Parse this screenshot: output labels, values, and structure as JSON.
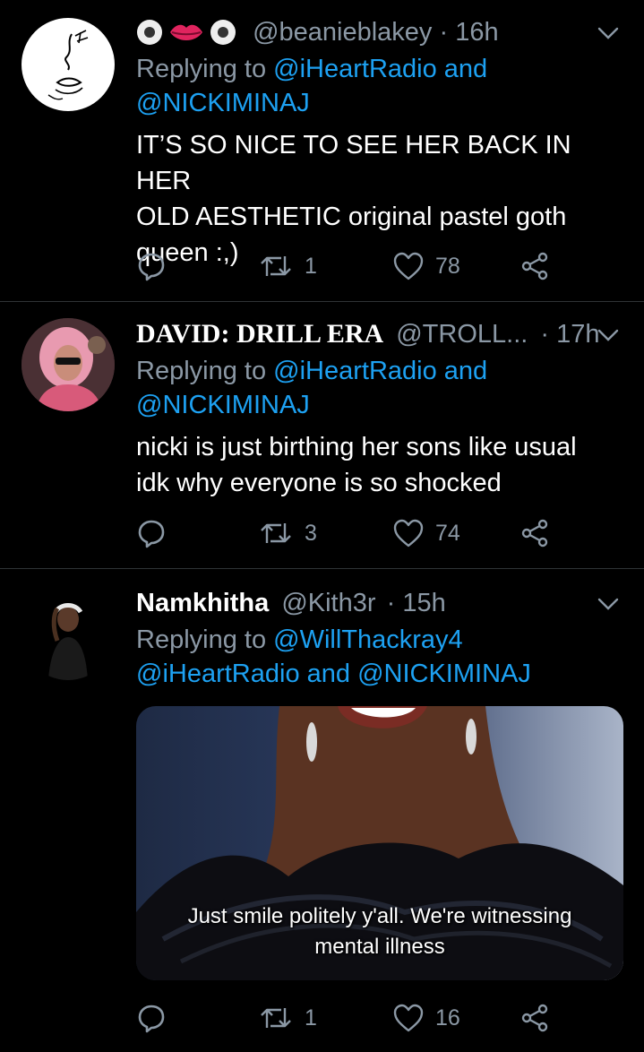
{
  "tweets": [
    {
      "name": "",
      "name_emojis": [
        "eye-emoji",
        "lips-emoji",
        "eye-emoji"
      ],
      "handle": "@beanieblakey",
      "time": "16h",
      "reply_prefix": "Replying to",
      "reply_line1": "@iHeartRadio and",
      "reply_line2": "@NICKIMINAJ",
      "body_lines": [
        "IT’S SO NICE TO SEE HER BACK IN HER",
        "OLD AESTHETIC original pastel goth",
        "queen :,)"
      ],
      "retweets": "1",
      "likes": "78"
    },
    {
      "name": "DAVID: DRILL ERA",
      "handle": "@TROLL...",
      "time": "17h",
      "reply_prefix": "Replying to",
      "reply_line1": "@iHeartRadio and",
      "reply_line2": "@NICKIMINAJ",
      "body_lines": [
        "nicki is just birthing her sons like usual",
        "idk why everyone is so shocked"
      ],
      "retweets": "3",
      "likes": "74"
    },
    {
      "name": "Namkhitha",
      "handle": "@Kith3r",
      "time": "15h",
      "reply_prefix": "Replying to",
      "reply_line1": "@WillThackray4",
      "reply_line2": "@iHeartRadio and @NICKIMINAJ",
      "media_caption_lines": [
        "Just smile politely y'all. We're witnessing",
        "mental illness"
      ],
      "retweets": "1",
      "likes": "16"
    }
  ],
  "separator": "·",
  "colors": {
    "background": "#000000",
    "secondary_text": "#8b98a5",
    "link": "#1da1f2",
    "divider": "#2f3336"
  }
}
